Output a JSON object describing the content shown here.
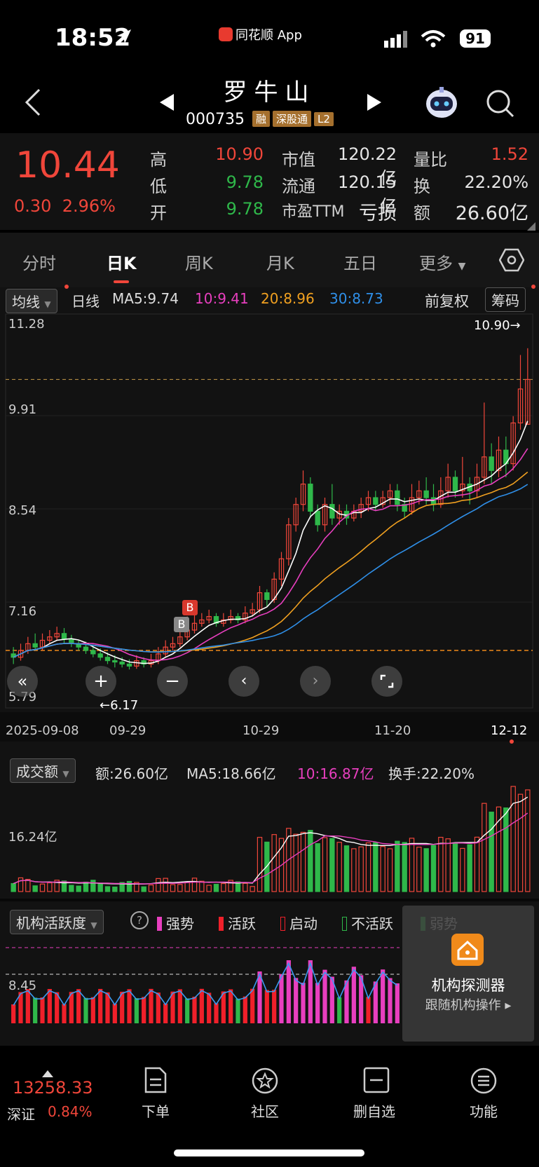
{
  "status_bar": {
    "time": "18:52",
    "app": "同花顺 App",
    "battery": "91"
  },
  "header": {
    "title": "罗牛山",
    "code": "000735",
    "tags": [
      "融",
      "深股通",
      "L2"
    ]
  },
  "quote": {
    "price": "10.44",
    "change": "0.30",
    "change_pct": "2.96%",
    "high_label": "高",
    "high": "10.90",
    "low_label": "低",
    "low": "9.78",
    "open_label": "开",
    "open": "9.78",
    "mcap_label": "市值",
    "mcap": "120.22亿",
    "float_label": "流通",
    "float": "120.15亿",
    "pe_label": "市盈TTM",
    "pe": "亏损",
    "vr_label": "量比",
    "vr": "1.52",
    "turn_label": "换",
    "turn": "22.20%",
    "amt_label": "额",
    "amt": "26.60亿"
  },
  "tabs": [
    "分时",
    "日K",
    "周K",
    "月K",
    "五日",
    "更多"
  ],
  "active_tab": "日K",
  "ma_bar": {
    "selector": "均线",
    "period": "日线",
    "ma5": "MA5:9.74",
    "ma10": "10:9.41",
    "ma20": "20:8.96",
    "ma30": "30:8.73",
    "adjust": "前复权",
    "chips": "筹码"
  },
  "price_axis": [
    "11.28",
    "9.91",
    "8.54",
    "7.16",
    "5.79"
  ],
  "max_label": "10.90→",
  "min_label": "←6.17",
  "date_axis": [
    "2025-09-08",
    "09-29",
    "10-29",
    "11-20",
    "12-12"
  ],
  "volume_bar": {
    "selector": "成交额",
    "amt": "额:26.60亿",
    "ma5": "MA5:18.66亿",
    "ma10": "10:16.87亿",
    "turnover": "换手:22.20%",
    "axis": "16.24亿"
  },
  "inst_bar": {
    "selector": "机构活跃度",
    "legend": [
      "强势",
      "活跃",
      "启动",
      "不活跃",
      "弱势"
    ],
    "axis": "8.45"
  },
  "inst_overlay": {
    "title": "机构探测器",
    "subtitle": "跟随机构操作 ▸"
  },
  "bottom": {
    "index_value": "13258.33",
    "index_name": "深证",
    "index_pct": "0.84%",
    "items": [
      "下单",
      "社区",
      "删自选",
      "功能"
    ]
  },
  "colors": {
    "up": "#f0463a",
    "down": "#2fb84a",
    "ma5": "#ffffff",
    "ma10": "#e83fbf",
    "ma20": "#f0a020",
    "ma30": "#2f8fe8"
  },
  "chart_data": {
    "type": "candlestick",
    "ylim": [
      5.79,
      11.28
    ],
    "candles": [
      [
        6.4,
        6.35,
        6.5,
        6.25
      ],
      [
        6.35,
        6.45,
        6.55,
        6.3
      ],
      [
        6.45,
        6.55,
        6.65,
        6.4
      ],
      [
        6.55,
        6.5,
        6.7,
        6.45
      ],
      [
        6.5,
        6.6,
        6.7,
        6.45
      ],
      [
        6.6,
        6.65,
        6.75,
        6.55
      ],
      [
        6.65,
        6.7,
        6.8,
        6.6
      ],
      [
        6.7,
        6.62,
        6.78,
        6.55
      ],
      [
        6.62,
        6.55,
        6.68,
        6.5
      ],
      [
        6.55,
        6.5,
        6.6,
        6.45
      ],
      [
        6.5,
        6.45,
        6.58,
        6.4
      ],
      [
        6.45,
        6.4,
        6.52,
        6.35
      ],
      [
        6.4,
        6.35,
        6.48,
        6.3
      ],
      [
        6.35,
        6.3,
        6.42,
        6.25
      ],
      [
        6.3,
        6.28,
        6.38,
        6.2
      ],
      [
        6.28,
        6.25,
        6.35,
        6.2
      ],
      [
        6.25,
        6.22,
        6.32,
        6.17
      ],
      [
        6.22,
        6.3,
        6.38,
        6.18
      ],
      [
        6.3,
        6.25,
        6.35,
        6.2
      ],
      [
        6.25,
        6.3,
        6.4,
        6.2
      ],
      [
        6.3,
        6.4,
        6.5,
        6.25
      ],
      [
        6.4,
        6.5,
        6.6,
        6.35
      ],
      [
        6.5,
        6.55,
        6.65,
        6.45
      ],
      [
        6.55,
        6.65,
        6.75,
        6.5
      ],
      [
        6.65,
        6.75,
        6.95,
        6.6
      ],
      [
        6.75,
        6.85,
        7.0,
        6.7
      ],
      [
        6.85,
        6.9,
        7.0,
        6.8
      ],
      [
        6.9,
        6.95,
        7.05,
        6.85
      ],
      [
        6.95,
        6.85,
        7.0,
        6.8
      ],
      [
        6.85,
        6.9,
        7.0,
        6.8
      ],
      [
        6.9,
        6.95,
        7.05,
        6.85
      ],
      [
        6.95,
        6.9,
        7.0,
        6.85
      ],
      [
        6.9,
        7.0,
        7.1,
        6.85
      ],
      [
        7.0,
        7.05,
        7.15,
        6.95
      ],
      [
        7.05,
        7.3,
        7.4,
        7.0
      ],
      [
        7.3,
        7.2,
        7.35,
        7.1
      ],
      [
        7.2,
        7.5,
        7.6,
        7.15
      ],
      [
        7.5,
        7.8,
        7.9,
        7.4
      ],
      [
        7.8,
        8.3,
        8.4,
        7.7
      ],
      [
        8.3,
        8.6,
        8.7,
        8.2
      ],
      [
        8.6,
        8.9,
        9.1,
        8.5
      ],
      [
        8.9,
        8.5,
        9.0,
        8.4
      ],
      [
        8.5,
        8.3,
        8.6,
        8.2
      ],
      [
        8.3,
        8.6,
        8.7,
        8.2
      ],
      [
        8.6,
        8.4,
        8.9,
        8.3
      ],
      [
        8.4,
        8.5,
        8.6,
        8.3
      ],
      [
        8.5,
        8.4,
        8.6,
        8.3
      ],
      [
        8.4,
        8.5,
        8.6,
        8.35
      ],
      [
        8.5,
        8.6,
        8.7,
        8.4
      ],
      [
        8.6,
        8.7,
        8.8,
        8.5
      ],
      [
        8.7,
        8.6,
        8.8,
        8.5
      ],
      [
        8.6,
        8.7,
        8.8,
        8.55
      ],
      [
        8.7,
        8.8,
        8.9,
        8.6
      ],
      [
        8.8,
        8.6,
        8.9,
        8.5
      ],
      [
        8.6,
        8.5,
        8.7,
        8.4
      ],
      [
        8.5,
        8.7,
        8.9,
        8.45
      ],
      [
        8.7,
        8.8,
        8.95,
        8.6
      ],
      [
        8.8,
        8.7,
        9.0,
        8.6
      ],
      [
        8.7,
        8.6,
        8.9,
        8.5
      ],
      [
        8.6,
        8.8,
        9.0,
        8.55
      ],
      [
        8.8,
        9.0,
        9.2,
        8.7
      ],
      [
        9.0,
        8.8,
        9.1,
        8.7
      ],
      [
        8.8,
        8.9,
        9.3,
        8.7
      ],
      [
        8.9,
        8.8,
        9.0,
        8.6
      ],
      [
        8.8,
        9.0,
        9.2,
        8.7
      ],
      [
        9.0,
        9.3,
        10.1,
        8.9
      ],
      [
        9.3,
        9.1,
        9.5,
        8.9
      ],
      [
        9.1,
        9.4,
        9.6,
        9.0
      ],
      [
        9.4,
        9.2,
        9.6,
        9.0
      ],
      [
        9.2,
        9.8,
        9.9,
        9.1
      ],
      [
        9.8,
        10.3,
        10.8,
        9.7
      ],
      [
        9.78,
        10.44,
        10.9,
        9.78
      ]
    ]
  }
}
